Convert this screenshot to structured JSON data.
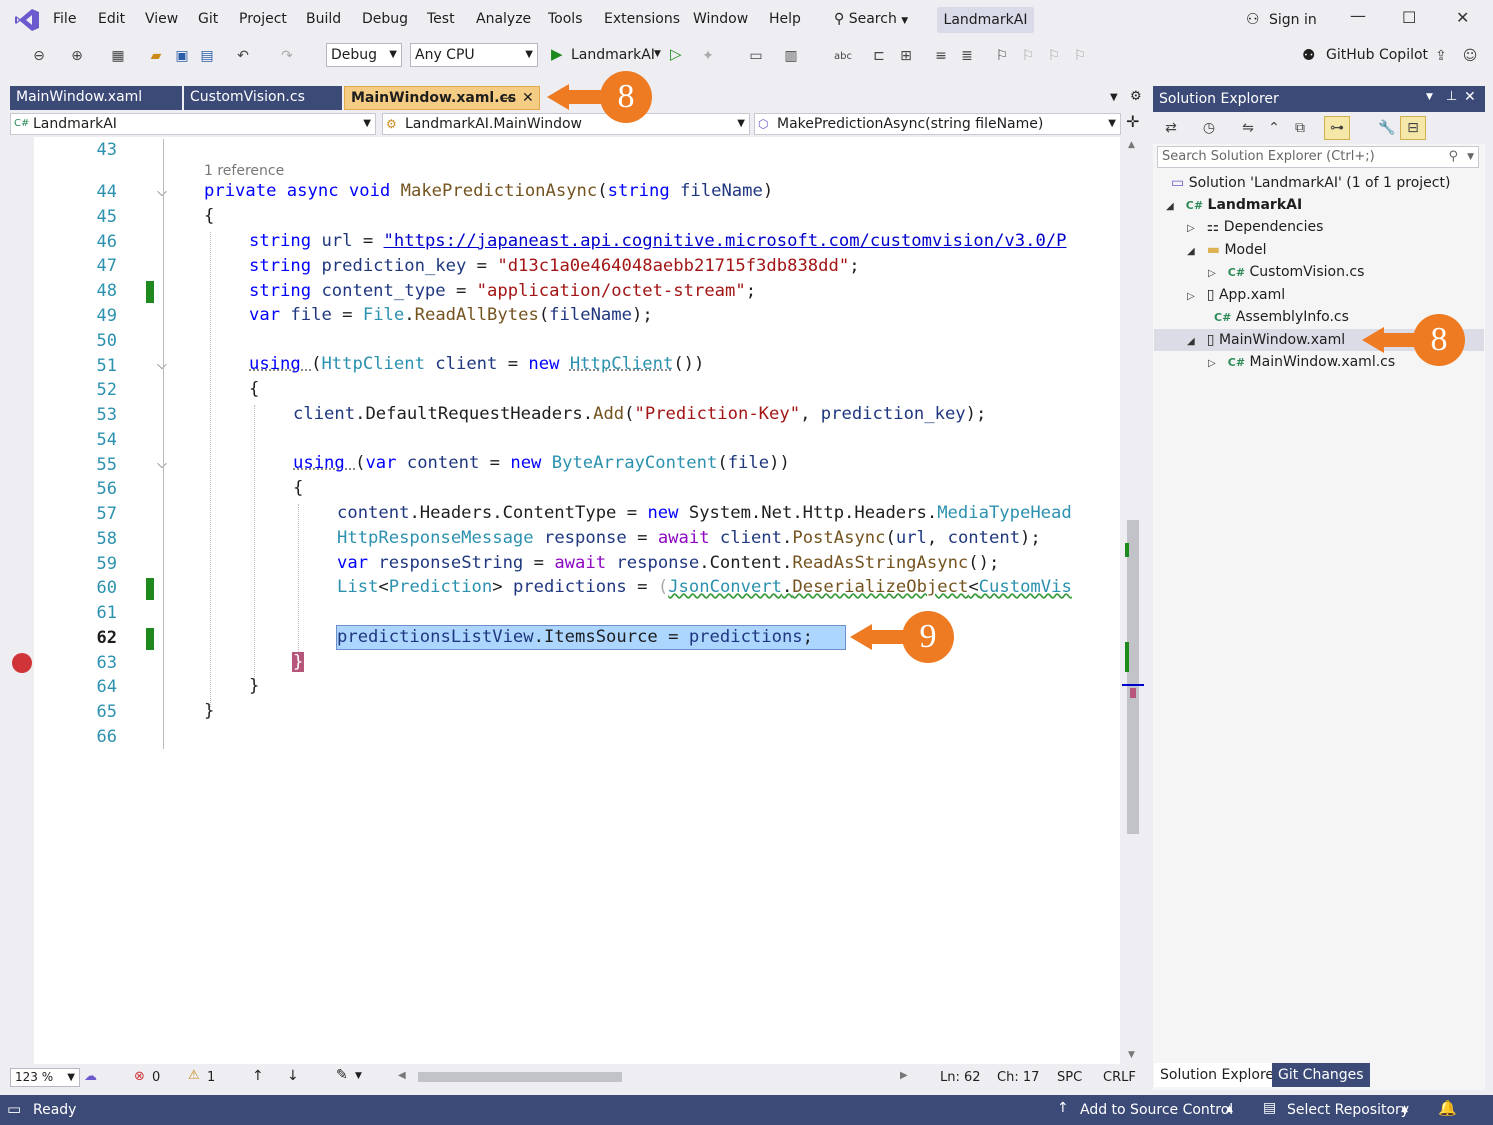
{
  "menu": [
    "File",
    "Edit",
    "View",
    "Git",
    "Project",
    "Build",
    "Debug",
    "Test",
    "Analyze",
    "Tools",
    "Extensions",
    "Window",
    "Help"
  ],
  "search_label": "Search",
  "solution_name": "LandmarkAI",
  "sign_in": "Sign in",
  "toolbar": {
    "config": "Debug",
    "platform": "Any CPU",
    "run_target": "LandmarkAI",
    "copilot": "GitHub Copilot"
  },
  "tabs": [
    {
      "label": "MainWindow.xaml"
    },
    {
      "label": "CustomVision.cs"
    },
    {
      "label": "MainWindow.xaml.cs"
    }
  ],
  "nav": {
    "project": "LandmarkAI",
    "class": "LandmarkAI.MainWindow",
    "member": "MakePredictionAsync(string fileName)"
  },
  "code": {
    "reference": "1 reference",
    "line_numbers": [
      "43",
      "44",
      "45",
      "46",
      "47",
      "48",
      "49",
      "50",
      "51",
      "52",
      "53",
      "54",
      "55",
      "56",
      "57",
      "58",
      "59",
      "60",
      "61",
      "62",
      "63",
      "64",
      "65",
      "66"
    ],
    "l44": [
      "private ",
      "async ",
      "void ",
      "MakePredictionAsync",
      "(",
      "string ",
      "fileName",
      ")"
    ],
    "l45": "{",
    "l46": [
      "string ",
      "url ",
      "= ",
      "\"https://japaneast.api.cognitive.microsoft.com/customvision/v3.0/P"
    ],
    "l47": [
      "string ",
      "prediction_key ",
      "= ",
      "\"d13c1a0e464048aebb21715f3db838dd\"",
      ";"
    ],
    "l48": [
      "string ",
      "content_type ",
      "= ",
      "\"application/octet-stream\"",
      ";"
    ],
    "l49": [
      "var ",
      "file ",
      "= ",
      "File",
      ".",
      "ReadAllBytes",
      "(",
      "fileName",
      ");"
    ],
    "l51": [
      "using ",
      "(",
      "HttpClient ",
      "client ",
      "= ",
      "new ",
      "HttpClient",
      "())"
    ],
    "l52": "{",
    "l53": [
      "client",
      ".DefaultRequestHeaders.",
      "Add",
      "(",
      "\"Prediction-Key\"",
      ", ",
      "prediction_key",
      ");"
    ],
    "l55": [
      "using ",
      "(",
      "var ",
      "content ",
      "= ",
      "new ",
      "ByteArrayContent",
      "(",
      "file",
      "))"
    ],
    "l56": "{",
    "l57": [
      "content",
      ".Headers.ContentType = ",
      "new ",
      "System.Net.Http.Headers.",
      "MediaTypeHead"
    ],
    "l58": [
      "HttpResponseMessage ",
      "response ",
      "= ",
      "await ",
      "client",
      ".",
      "PostAsync",
      "(",
      "url",
      ", ",
      "content",
      ");"
    ],
    "l59": [
      "var ",
      "responseString ",
      "= ",
      "await ",
      "response",
      ".Content.",
      "ReadAsStringAsync",
      "();"
    ],
    "l60": [
      "List",
      "<",
      "Prediction",
      "> ",
      "predictions ",
      "= ",
      "(",
      "JsonConvert",
      ".",
      "DeserializeObject",
      "<",
      "CustomVis"
    ],
    "l62": [
      "predictionsListView",
      ".ItemsSource = ",
      "predictions",
      ";"
    ],
    "l63": "}",
    "l64": "}",
    "l65": "}"
  },
  "editor_status": {
    "zoom": "123 %",
    "errors": "0",
    "warnings": "1",
    "ln": "Ln: 62",
    "ch": "Ch: 17",
    "spc": "SPC",
    "crlf": "CRLF"
  },
  "status": {
    "ready": "Ready",
    "source_control": "Add to Source Control",
    "repo": "Select Repository"
  },
  "solution_explorer": {
    "title": "Solution Explorer",
    "search_placeholder": "Search Solution Explorer (Ctrl+;)",
    "items": [
      {
        "label": "Solution 'LandmarkAI' (1 of 1 project)"
      },
      {
        "label": "LandmarkAI"
      },
      {
        "label": "Dependencies"
      },
      {
        "label": "Model"
      },
      {
        "label": "CustomVision.cs"
      },
      {
        "label": "App.xaml"
      },
      {
        "label": "AssemblyInfo.cs"
      },
      {
        "label": "MainWindow.xaml"
      },
      {
        "label": "MainWindow.xaml.cs"
      }
    ],
    "bottom_tabs": [
      "Solution Explorer",
      "Git Changes"
    ]
  },
  "callouts": [
    "8",
    "8",
    "9"
  ],
  "colors": {
    "accent": "#3c4a78",
    "callout": "#ee7a22",
    "active_tab": "#f5cc84"
  }
}
